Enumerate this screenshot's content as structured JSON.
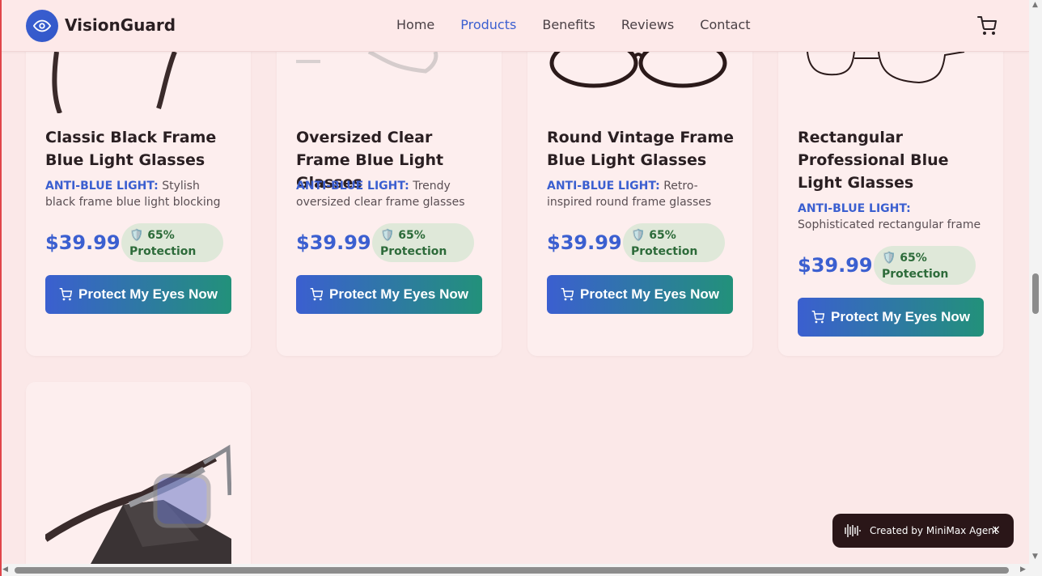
{
  "header": {
    "brand": "VisionGuard",
    "nav": [
      "Home",
      "Products",
      "Benefits",
      "Reviews",
      "Contact"
    ],
    "active_nav": "Products"
  },
  "products": [
    {
      "title": "Classic Black Frame Blue Light Glasses",
      "tag": "ANTI-BLUE LIGHT:",
      "desc": "Stylish black frame blue light blocking glasses",
      "price": "$39.99",
      "protection": "🛡️ 65% Protection",
      "button": "Protect My Eyes Now"
    },
    {
      "title": "Oversized Clear Frame Blue Light Glasses",
      "tag": "ANTI-BLUE LIGHT:",
      "desc": "Trendy oversized clear frame glasses",
      "price": "$39.99",
      "protection": "🛡️ 65% Protection",
      "button": "Protect My Eyes Now"
    },
    {
      "title": "Round Vintage Frame Blue Light Glasses",
      "tag": "ANTI-BLUE LIGHT:",
      "desc": "Retro-inspired round frame glasses",
      "price": "$39.99",
      "protection": "🛡️ 65% Protection",
      "button": "Protect My Eyes Now"
    },
    {
      "title": "Rectangular Professional Blue Light Glasses",
      "tag": "ANTI-BLUE LIGHT:",
      "desc": "Sophisticated rectangular frame glasses",
      "price": "$39.99",
      "protection": "🛡️ 65% Protection",
      "button": "Protect My Eyes Now"
    }
  ],
  "toast": {
    "text": "Created by MiniMax Agent",
    "close": "×"
  },
  "colors": {
    "accent": "#3b5fd0",
    "teal": "#22917a",
    "background": "#fbe8e8"
  }
}
